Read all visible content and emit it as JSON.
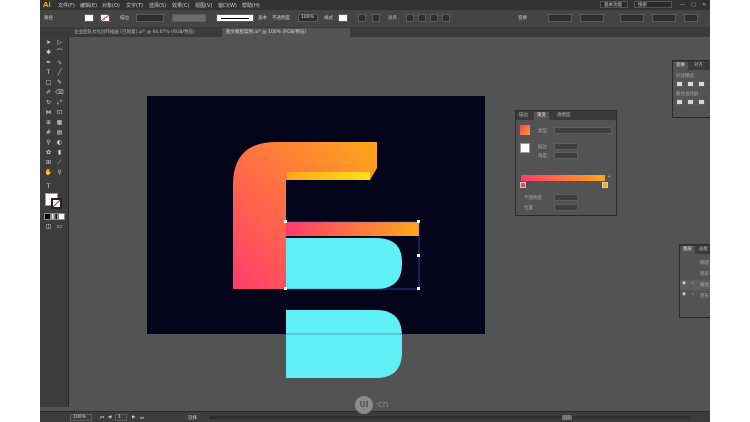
{
  "app": {
    "logo": "Ai",
    "menus": [
      "文件(F)",
      "编辑(E)",
      "对象(O)",
      "文字(T)",
      "选择(S)",
      "效果(C)",
      "视图(V)",
      "窗口(W)",
      "帮助(H)"
    ],
    "layout_mode": "基本功能",
    "search_label": "搜索"
  },
  "controlbar": {
    "path_label": "路径",
    "stroke_label": "描边",
    "uniform_label": "基本",
    "opacity_label": "不透明度",
    "opacity_value": "100%",
    "style_label": "样式",
    "align_label": "对齐",
    "transform_label": "变换"
  },
  "tabs": [
    {
      "label": "企业团队文化创作插画 [已恢复].ai* @ 66.67% (RGB/预览)"
    },
    {
      "label": "图文教程案例.ai* @ 100% (RGB/预览)"
    }
  ],
  "gradient_panel": {
    "tabs": [
      "描边",
      "渐变",
      "透明度"
    ],
    "type_label": "类型",
    "stroke_label": "描边",
    "angle_label": "角度",
    "opacity_label": "不透明度",
    "location_label": "位置",
    "colors": {
      "start": "#ff3b6b",
      "end": "#ffa71a"
    }
  },
  "right_top_panel": {
    "tabs": [
      "变换",
      "对齐"
    ],
    "row1": "路径查找器",
    "row2": "形状模式"
  },
  "layers_panel": {
    "tabs": [
      "图层",
      "画板"
    ],
    "rows": [
      "椭圆",
      "矩形",
      "路径",
      "矩形"
    ]
  },
  "statusbar": {
    "zoom": "100%",
    "page": "1",
    "mode": "选择"
  },
  "watermark": {
    "text": "UI",
    "suffix": "·cn"
  },
  "colors": {
    "art_bg": "#03031a",
    "orange": "#ffa71a",
    "pink": "#ff3b6b",
    "cyan": "#5ff0f5",
    "yellow": "#ffd21a"
  }
}
